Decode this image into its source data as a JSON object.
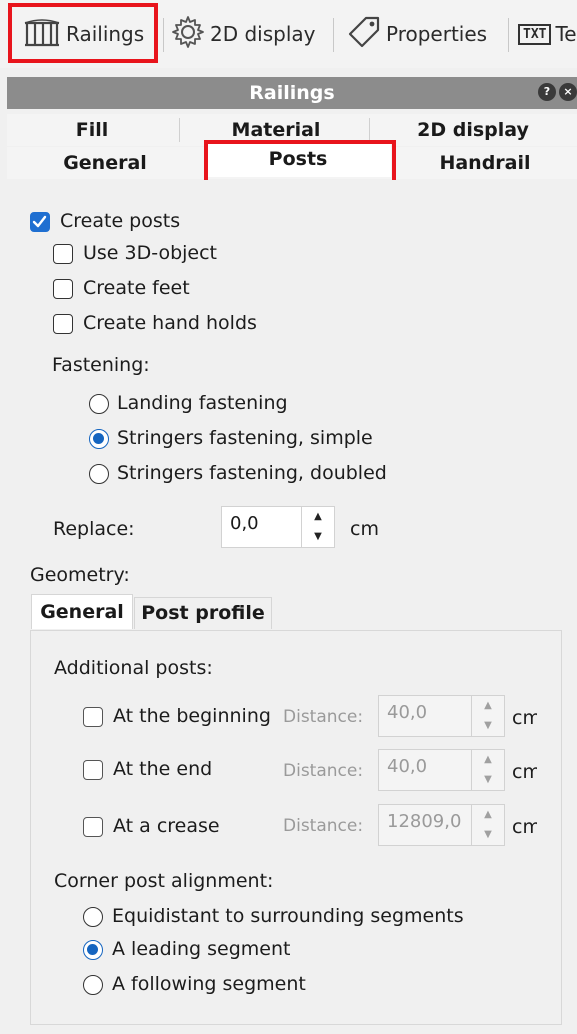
{
  "toolbar": {
    "railings_label": "Railings",
    "display2d_label": "2D display",
    "properties_label": "Properties",
    "txt_icon": "TXT",
    "txt_label": "Te"
  },
  "panel": {
    "title": "Railings",
    "help_icon": "?",
    "close_icon": "×"
  },
  "tabs": {
    "row1": [
      "Fill",
      "Material",
      "2D display"
    ],
    "row2": [
      "General",
      "Posts",
      "Handrail"
    ],
    "active": "Posts"
  },
  "posts": {
    "create_posts": {
      "label": "Create posts",
      "checked": true
    },
    "use_3d_object": {
      "label": "Use 3D-object",
      "checked": false
    },
    "create_feet": {
      "label": "Create feet",
      "checked": false
    },
    "create_hand_holds": {
      "label": "Create hand holds",
      "checked": false
    },
    "fastening_label": "Fastening:",
    "fastening_options": [
      "Landing fastening",
      "Stringers fastening, simple",
      "Stringers fastening, doubled"
    ],
    "fastening_selected": "Stringers fastening, simple",
    "replace_label": "Replace:",
    "replace_value": "0,0",
    "replace_unit": "cm"
  },
  "geometry": {
    "label": "Geometry:",
    "subtabs": [
      "General",
      "Post profile"
    ],
    "active_subtab": "General",
    "additional_posts_label": "Additional posts:",
    "additional_posts": [
      {
        "label": "At the beginning",
        "distance_label": "Distance:",
        "value": "40,0",
        "unit": "cm",
        "checked": false
      },
      {
        "label": "At the end",
        "distance_label": "Distance:",
        "value": "40,0",
        "unit": "cm",
        "checked": false
      },
      {
        "label": "At a crease",
        "distance_label": "Distance:",
        "value": "12809,0",
        "unit": "cm",
        "checked": false
      }
    ],
    "corner_label": "Corner post alignment:",
    "corner_options": [
      "Equidistant to surrounding segments",
      "A leading segment",
      "A following segment"
    ],
    "corner_selected": "A leading segment"
  },
  "colors": {
    "highlight": "#e8141c",
    "accent": "#1565c0",
    "panel_header": "#8c8c8c"
  }
}
